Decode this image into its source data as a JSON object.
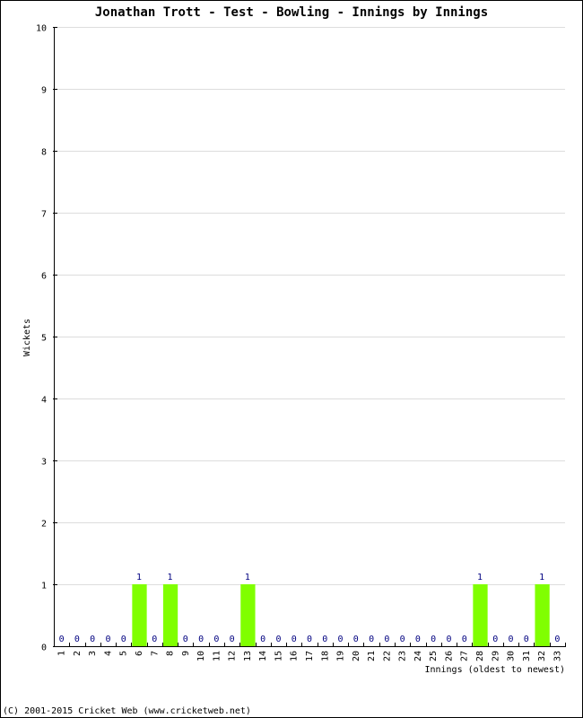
{
  "chart_data": {
    "type": "bar",
    "title": "Jonathan Trott - Test - Bowling - Innings by Innings",
    "xlabel": "Innings (oldest to newest)",
    "ylabel": "Wickets",
    "ylim": [
      0,
      10
    ],
    "yticks": [
      0,
      1,
      2,
      3,
      4,
      5,
      6,
      7,
      8,
      9,
      10
    ],
    "grid": true,
    "categories": [
      "1",
      "2",
      "3",
      "4",
      "5",
      "6",
      "7",
      "8",
      "9",
      "10",
      "11",
      "12",
      "13",
      "14",
      "15",
      "16",
      "17",
      "18",
      "19",
      "20",
      "21",
      "22",
      "23",
      "24",
      "25",
      "26",
      "27",
      "28",
      "29",
      "30",
      "31",
      "32",
      "33"
    ],
    "values": [
      0,
      0,
      0,
      0,
      0,
      1,
      0,
      1,
      0,
      0,
      0,
      0,
      1,
      0,
      0,
      0,
      0,
      0,
      0,
      0,
      0,
      0,
      0,
      0,
      0,
      0,
      0,
      1,
      0,
      0,
      0,
      1,
      0
    ],
    "bar_color": "#80ff00",
    "label_color": "#000080"
  },
  "footer": "(C) 2001-2015 Cricket Web (www.cricketweb.net)"
}
